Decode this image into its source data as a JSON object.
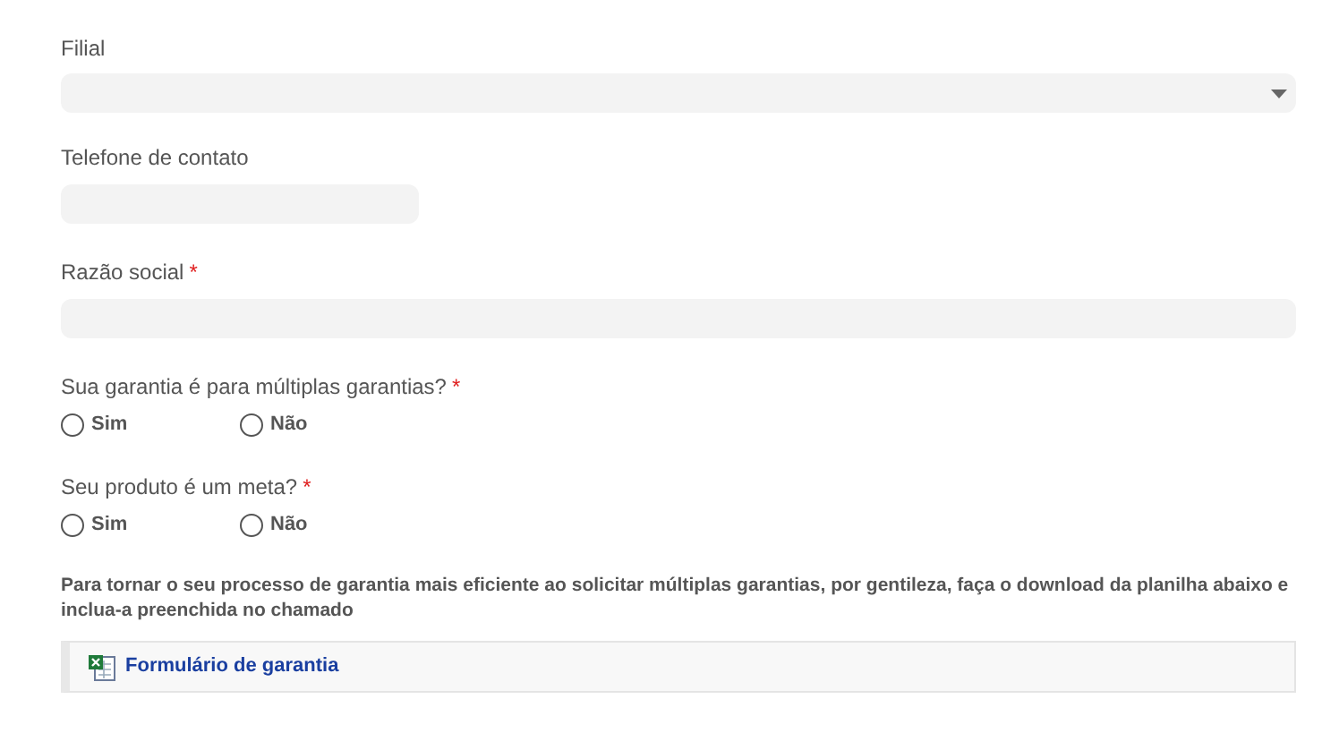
{
  "fields": [
    {
      "kind": "select",
      "label": "Filial",
      "required": false
    },
    {
      "kind": "text",
      "label": "Telefone de contato",
      "required": false,
      "short": true
    },
    {
      "kind": "text",
      "label": "Razão social",
      "required": true,
      "short": false
    },
    {
      "kind": "radio",
      "label": "Sua garantia é para múltiplas garantias?",
      "required": true,
      "options": [
        {
          "label": "Sim",
          "selected": false
        },
        {
          "label": "Não",
          "selected": false
        }
      ]
    },
    {
      "kind": "radio",
      "label": "Seu produto é um meta?",
      "required": true,
      "options": [
        {
          "label": "Sim",
          "selected": false
        },
        {
          "label": "Não",
          "selected": false
        }
      ]
    }
  ],
  "required_mark": "*",
  "notice": "Para tornar o seu processo de garantia mais eficiente ao solicitar múltiplas garantias, por gentileza, faça o download da planilha abaixo e inclua-a preenchida no chamado",
  "attachment": {
    "label": "Formulário de garantia"
  }
}
